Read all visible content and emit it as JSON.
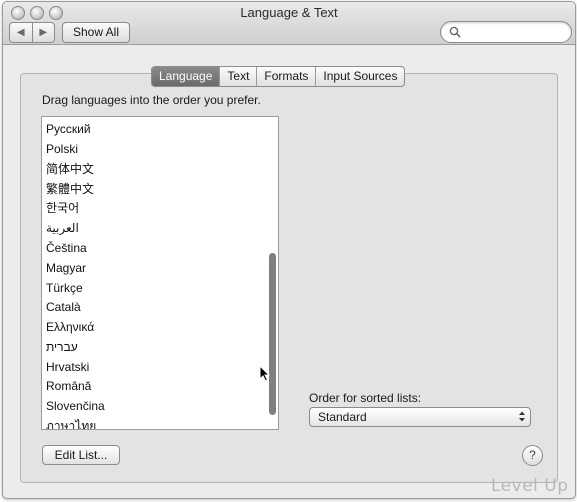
{
  "window": {
    "title": "Language & Text",
    "show_all_label": "Show All",
    "back_glyph": "◀",
    "forward_glyph": "▶"
  },
  "tabs": [
    {
      "label": "Language",
      "active": true
    },
    {
      "label": "Text",
      "active": false
    },
    {
      "label": "Formats",
      "active": false
    },
    {
      "label": "Input Sources",
      "active": false
    }
  ],
  "language_pane": {
    "instruction": "Drag languages into the order you prefer.",
    "languages": [
      "Русский",
      "Polski",
      "简体中文",
      "繁體中文",
      "한국어",
      "العربية",
      "Čeština",
      "Magyar",
      "Türkçe",
      "Català",
      "Ελληνικά",
      "עברית",
      "Hrvatski",
      "Română",
      "Slovenčina",
      "ภาษาไทย"
    ],
    "edit_list_label": "Edit List..."
  },
  "sort_order": {
    "label": "Order for sorted lists:",
    "selected": "Standard"
  },
  "help": {
    "glyph": "?"
  },
  "watermark": "Level Up"
}
